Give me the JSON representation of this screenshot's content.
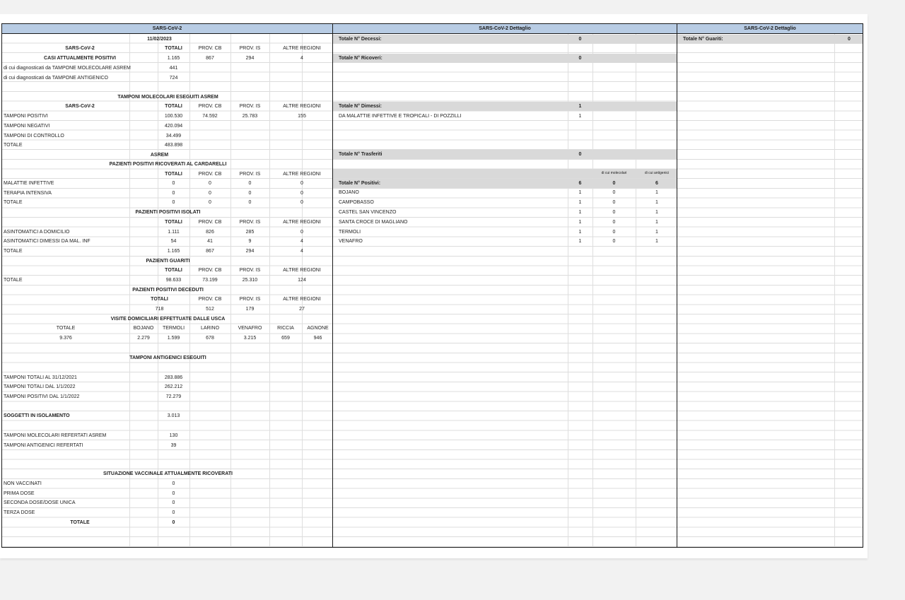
{
  "left": {
    "header": "SARS-CoV-2",
    "date": "11/02/2023",
    "col_totali": "TOTALI",
    "col_cb": "PROV. CB",
    "col_is": "PROV. IS",
    "col_altre": "ALTRE REGIONI",
    "sars_label": "SARS-CoV-2",
    "positivi": {
      "label": "CASI ATTUALMENTE POSITIVI",
      "tot": "1.165",
      "cb": "867",
      "is": "294",
      "altre": "4"
    },
    "molecolare": {
      "label": "di cui diagnosticati da TAMPONE MOLECOLARE ASREM",
      "value": "441"
    },
    "antigenico": {
      "label": "di cui diagnosticati da TAMPONE ANTIGENICO",
      "value": "724"
    },
    "tamponi_title": "TAMPONI MOLECOLARI ESEGUITI ASREM",
    "tamponi_sars": "SARS-CoV-2",
    "tamponi_positivi": {
      "label": "TAMPONI POSITIVI",
      "tot": "100.530",
      "cb": "74.592",
      "is": "25.783",
      "altre": "155"
    },
    "tamponi_negativi": {
      "label": "TAMPONI NEGATIVI",
      "tot": "420.094"
    },
    "tamponi_controllo": {
      "label": "TAMPONI DI CONTROLLO",
      "tot": "34.499"
    },
    "tamponi_totale": {
      "label": "TOTALE",
      "tot": "483.898"
    },
    "asrem": "ASREM",
    "ricoverati_title": "PAZIENTI POSITIVI RICOVERATI AL CARDARELLI",
    "mal_inf": {
      "label": "MALATTIE INFETTIVE",
      "tot": "0",
      "cb": "0",
      "is": "0",
      "altre": "0"
    },
    "ter_int": {
      "label": "TERAPIA INTENSIVA",
      "tot": "0",
      "cb": "0",
      "is": "0",
      "altre": "0"
    },
    "ric_totale": {
      "label": "TOTALE",
      "tot": "0",
      "cb": "0",
      "is": "0",
      "altre": "0"
    },
    "isolati_title": "PAZIENTI POSITIVI ISOLATI",
    "asint_dom": {
      "label": "ASINTOMATICI A DOMICILIO",
      "tot": "1.111",
      "cb": "826",
      "is": "285",
      "altre": "0"
    },
    "asint_dim": {
      "label": "ASINTOMATICI DIMESSI DA MAL. INF",
      "tot": "54",
      "cb": "41",
      "is": "9",
      "altre": "4"
    },
    "iso_totale": {
      "label": "TOTALE",
      "tot": "1.165",
      "cb": "867",
      "is": "294",
      "altre": "4"
    },
    "guariti_title": "PAZIENTI GUARITI",
    "guariti_totale": {
      "label": "TOTALE",
      "tot": "98.633",
      "cb": "73.199",
      "is": "25.310",
      "altre": "124"
    },
    "deceduti_title": "PAZIENTI POSITIVI DECEDUTI",
    "deceduti": {
      "tot": "718",
      "cb": "512",
      "is": "179",
      "altre": "27"
    },
    "usca_title": "VISITE DOMICILIARI EFFETTUATE DALLE USCA",
    "usca_headers": [
      "TOTALE",
      "BOJANO",
      "TERMOLI",
      "LARINO",
      "VENAFRO",
      "RICCIA",
      "AGNONE"
    ],
    "usca_values": [
      "9.376",
      "2.279",
      "1.599",
      "678",
      "3.215",
      "659",
      "946"
    ],
    "antigenici_title": "TAMPONI ANTIGENICI ESEGUITI",
    "ant_totali_2021": {
      "label": "TAMPONI TOTALI AL 31/12/2021",
      "value": "283.886"
    },
    "ant_totali_2022": {
      "label": "TAMPONI TOTALI DAL 1/1/2022",
      "value": "262.212"
    },
    "ant_positivi_2022": {
      "label": "TAMPONI POSITIVI DAL 1/1/2022",
      "value": "72.279"
    },
    "isolamento": {
      "label": "SOGGETTI IN ISOLAMENTO",
      "value": "3.013"
    },
    "mol_refertati": {
      "label": "TAMPONI MOLECOLARI REFERTATI ASREM",
      "value": "130"
    },
    "ant_refertati": {
      "label": "TAMPONI ANTIGENICI REFERTATI",
      "value": "39"
    },
    "vacc_title": "SITUAZIONE VACCINALE ATTUALMENTE RICOVERATI",
    "non_vacc": {
      "label": "NON VACCINATI",
      "value": "0"
    },
    "prima_dose": {
      "label": "PRIMA DOSE",
      "value": "0"
    },
    "seconda_dose": {
      "label": "SECONDA DOSE/DOSE UNICA",
      "value": "0"
    },
    "terza_dose": {
      "label": "TERZA DOSE",
      "value": "0"
    },
    "vacc_totale": {
      "label": "TOTALE",
      "value": "0"
    }
  },
  "middle": {
    "header": "SARS-CoV-2 Dettaglio",
    "decessi": {
      "label": "Totale N° Decessi:",
      "value": "0"
    },
    "ricoveri": {
      "label": "Totale N° Ricoveri:",
      "value": "0"
    },
    "dimessi": {
      "label": "Totale N° Dimessi:",
      "value": "1"
    },
    "dimessi_reparto": {
      "label": "DA MALATTIE INFETTIVE E TROPICALI - DI POZZILLI",
      "value": "1"
    },
    "trasferiti": {
      "label": "Totale N° Trasferiti",
      "value": "0"
    },
    "col_molecolari": "di cui molecolari",
    "col_antigenici": "di cui antigenici",
    "positivi": {
      "label": "Totale N° Positivi:",
      "value": "6",
      "mol": "0",
      "ant": "6"
    },
    "comuni": [
      {
        "name": "BOJANO",
        "value": "1",
        "mol": "0",
        "ant": "1"
      },
      {
        "name": "CAMPOBASSO",
        "value": "1",
        "mol": "0",
        "ant": "1"
      },
      {
        "name": "CASTEL SAN VINCENZO",
        "value": "1",
        "mol": "0",
        "ant": "1"
      },
      {
        "name": "SANTA CROCE DI MAGLIANO",
        "value": "1",
        "mol": "0",
        "ant": "1"
      },
      {
        "name": "TERMOLI",
        "value": "1",
        "mol": "0",
        "ant": "1"
      },
      {
        "name": "VENAFRO",
        "value": "1",
        "mol": "0",
        "ant": "1"
      }
    ]
  },
  "right": {
    "header": "SARS-CoV-2 Dettaglio",
    "guariti": {
      "label": "Totale N° Guariti:",
      "value": "0"
    }
  }
}
